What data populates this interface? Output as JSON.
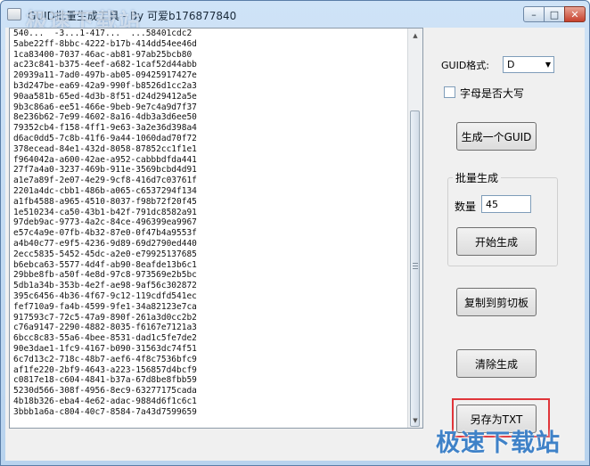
{
  "window": {
    "title": "GUID批量生成工具 - By 可爱b176877840",
    "watermark": "极速下载站",
    "buttons": {
      "minimize": "–",
      "maximize": "□",
      "close": "✕"
    }
  },
  "output": {
    "lines": [
      "540...  -3...1-417...  ...58401cdc2",
      "5abe22ff-8bbc-4222-b17b-414dd54ee46d",
      "1ca83400-7037-46ac-ab81-97ab25bcb80",
      "ac23c841-b375-4eef-a682-1caf52d44abb",
      "20939a11-7ad0-497b-ab05-09425917427e",
      "b3d247be-ea69-42a9-990f-b8526d1cc2a3",
      "90aa581b-65ed-4d3b-8f51-d24d29412a5e",
      "9b3c86a6-ee51-466e-9beb-9e7c4a9d7f37",
      "8e236b62-7e99-4602-8a16-4db3a3d6ee50",
      "79352cb4-f158-4ff1-9e63-3a2e36d398a4",
      "d6ac0dd5-7c8b-41f6-9a44-1060dad70f72",
      "378ecead-84e1-432d-8058-87852cc1f1e1",
      "f964042a-a600-42ae-a952-cabbbdfda441",
      "27f7a4a0-3237-469b-911e-3569bcbd4d91",
      "a1e7a89f-2e07-4e29-9cf8-416d7c03761f",
      "2201a4dc-cbb1-486b-a065-c6537294f134",
      "a1fb4588-a965-4510-8037-f98b72f20f45",
      "1e510234-ca50-43b1-b42f-791dc8582a91",
      "97deb9ac-9773-4a2c-84ce-496399ea9967",
      "e57c4a9e-07fb-4b32-87e0-0f47b4a9553f",
      "a4b40c77-e9f5-4236-9d89-69d2790ed440",
      "2ecc5835-5452-45dc-a2e0-e79925137685",
      "b6ebca63-5577-4d4f-ab90-8eafde13b6c1",
      "29bbe8fb-a50f-4e8d-97c8-973569e2b5bc",
      "5db1a34b-353b-4e2f-ae98-9af56c302872",
      "395c6456-4b36-4f67-9c12-119cdfd541ec",
      "fef710a9-fa4b-4599-9fe1-34a82123e7ca",
      "917593c7-72c5-47a9-890f-261a3d0cc2b2",
      "c76a9147-2290-4882-8035-f6167e7121a3",
      "6bcc8c83-55a6-4bee-8531-dad1c5fe7de2",
      "90e3dae1-1fc9-4167-b090-31563dc74f51",
      "6c7d13c2-718c-48b7-aef6-4f8c7536bfc9",
      "af1fe220-2bf9-4643-a223-156857d4bcf9",
      "c0817e18-c604-4841-b37a-67d8be8fbb59",
      "5230d566-308f-4956-8ec9-63277175cada",
      "4b18b326-eba4-4e62-adac-9884d6f1c6c1",
      "3bbb1a6a-c804-40c7-8584-7a43d7599659"
    ],
    "scroll_up": "▲",
    "scroll_down": "▼"
  },
  "panel": {
    "format_label": "GUID格式:",
    "format_value": "D",
    "format_arrow": "▼",
    "uppercase_label": "字母是否大写",
    "generate_one": "生成一个GUID",
    "batch_title": "批量生成",
    "quantity_label": "数量",
    "quantity_value": "45",
    "start_batch": "开始生成",
    "copy_clipboard": "复制到剪切板",
    "clear": "清除生成",
    "save_txt": "另存为TXT"
  },
  "colors": {
    "highlight": "#e0353a",
    "watermark": "#3f82c8"
  }
}
